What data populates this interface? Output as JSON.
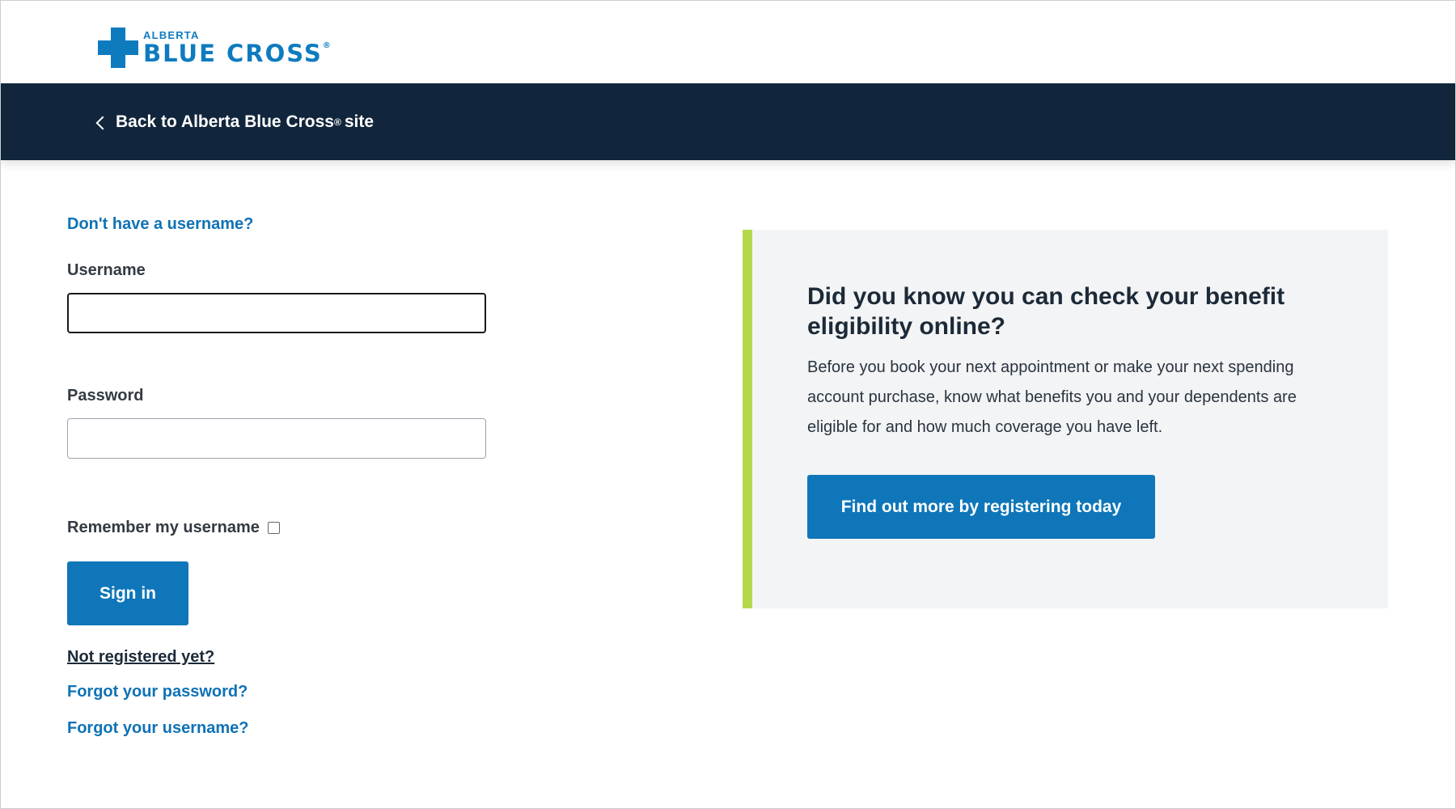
{
  "header": {
    "logo": {
      "small_text": "ALBERTA",
      "big_text": "BLUE CROSS",
      "reg_mark": "®",
      "icon": "blue-cross-logo-icon"
    }
  },
  "navbar": {
    "back_link_text": "Back to Alberta Blue Cross",
    "back_link_reg": "®",
    "back_link_suffix": "site",
    "back_icon": "chevron-left-icon"
  },
  "form": {
    "no_username_link": "Don't have a username?",
    "username_label": "Username",
    "username_value": "",
    "password_label": "Password",
    "password_value": "",
    "remember_label": "Remember my username",
    "remember_checked": false,
    "sign_in_label": "Sign in",
    "not_registered_link": "Not registered yet?",
    "forgot_password_link": "Forgot your password?",
    "forgot_username_link": "Forgot your username?"
  },
  "promo": {
    "title": "Did you know you can check your benefit eligibility online?",
    "body": "Before you book your next appointment or make your next spending account purchase, know what benefits you and your dependents are eligible for and how much coverage you have left.",
    "button_label": "Find out more by registering today"
  },
  "colors": {
    "brand_blue": "#0f7bbf",
    "navy": "#11263c",
    "button_blue": "#0e76b9",
    "accent_green": "#b5d94b",
    "card_bg": "#f3f4f5"
  }
}
